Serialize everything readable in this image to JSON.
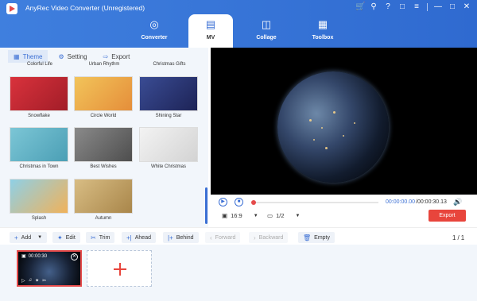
{
  "app": {
    "title": "AnyRec Video Converter (Unregistered)"
  },
  "window_icons": [
    "cart-icon",
    "key-icon",
    "help-icon",
    "chat-icon",
    "menu-icon",
    "minimize-icon",
    "maximize-icon",
    "close-icon"
  ],
  "nav": {
    "tabs": [
      {
        "label": "Converter",
        "icon": "converter-icon",
        "active": false
      },
      {
        "label": "MV",
        "icon": "mv-icon",
        "active": true
      },
      {
        "label": "Collage",
        "icon": "collage-icon",
        "active": false
      },
      {
        "label": "Toolbox",
        "icon": "toolbox-icon",
        "active": false
      }
    ]
  },
  "subtabs": [
    {
      "label": "Theme",
      "icon": "grid-icon",
      "active": true
    },
    {
      "label": "Setting",
      "icon": "gear-icon",
      "active": false
    },
    {
      "label": "Export",
      "icon": "export-icon",
      "active": false
    }
  ],
  "themes": {
    "header_labels": [
      "Colorful Life",
      "Urban Rhythm",
      "Christmas Gifts"
    ],
    "items": [
      {
        "label": "Snowflake",
        "color": "#c8303a"
      },
      {
        "label": "Circle World",
        "color": "#f0b24a"
      },
      {
        "label": "Shining Star",
        "color": "#2a3a78"
      },
      {
        "label": "Christmas in Town",
        "color": "#5fb3c6"
      },
      {
        "label": "Best Wishes",
        "color": "#6f6f6f"
      },
      {
        "label": "White Christmas",
        "color": "#e6e6e6"
      },
      {
        "label": "Splash",
        "color": "#6fbad8"
      },
      {
        "label": "Autumn",
        "color": "#c9a86a"
      }
    ]
  },
  "player": {
    "time_current": "00:00:00.00",
    "time_total": "/00:00:30.13",
    "progress": 0,
    "aspect_ratio": "16:9",
    "page": "1/2",
    "export_label": "Export"
  },
  "toolbar": {
    "add": "Add",
    "edit": "Edit",
    "trim": "Trim",
    "ahead": "Ahead",
    "behind": "Behind",
    "forward": "Forward",
    "backward": "Backward",
    "empty": "Empty",
    "pager_current": "1",
    "pager_separator": "/",
    "pager_total": "1"
  },
  "timeline": {
    "clip_duration": "00:00:30"
  },
  "colors": {
    "accent": "#3b6fd4",
    "topbar": "#3473d8",
    "export": "#e8453c"
  }
}
